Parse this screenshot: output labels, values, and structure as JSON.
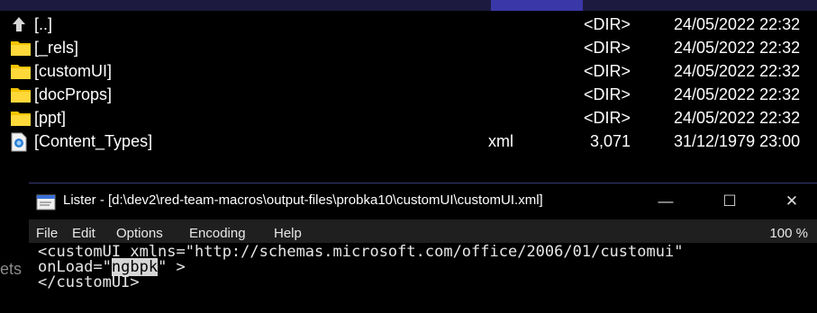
{
  "file_panel": {
    "rows": [
      {
        "name": "[..]",
        "ext": "",
        "size": "<DIR>",
        "date": "24/05/2022 22:32",
        "icon": "up-arrow-icon"
      },
      {
        "name": "[_rels]",
        "ext": "",
        "size": "<DIR>",
        "date": "24/05/2022 22:32",
        "icon": "folder-icon"
      },
      {
        "name": "[customUI]",
        "ext": "",
        "size": "<DIR>",
        "date": "24/05/2022 22:32",
        "icon": "folder-icon"
      },
      {
        "name": "[docProps]",
        "ext": "",
        "size": "<DIR>",
        "date": "24/05/2022 22:32",
        "icon": "folder-icon"
      },
      {
        "name": "[ppt]",
        "ext": "",
        "size": "<DIR>",
        "date": "24/05/2022 22:32",
        "icon": "folder-icon"
      },
      {
        "name": "[Content_Types]",
        "ext": "xml",
        "size": "3,071",
        "date": "31/12/1979 23:00",
        "icon": "xml-file-icon"
      }
    ]
  },
  "background_text": "ets",
  "lister": {
    "title": "Lister - [d:\\dev2\\red-team-macros\\output-files\\probka10\\customUI\\customUI.xml]",
    "window_buttons": {
      "minimize": "—",
      "maximize": "☐",
      "close": "✕"
    },
    "menu": [
      "File",
      "Edit",
      "Options",
      "Encoding",
      "Help"
    ],
    "zoom": "100 %",
    "content": {
      "line1": "<customUI xmlns=\"http://schemas.microsoft.com/office/2006/01/customui\"",
      "line2_before": "onLoad=\"",
      "line2_highlight": "ngbpk",
      "line2_after": "\" >",
      "line3": "</customUI>"
    }
  },
  "colors": {
    "folder": "#f4c400",
    "panel_bg": "#000000",
    "selection_bar": "#3a37a8"
  }
}
